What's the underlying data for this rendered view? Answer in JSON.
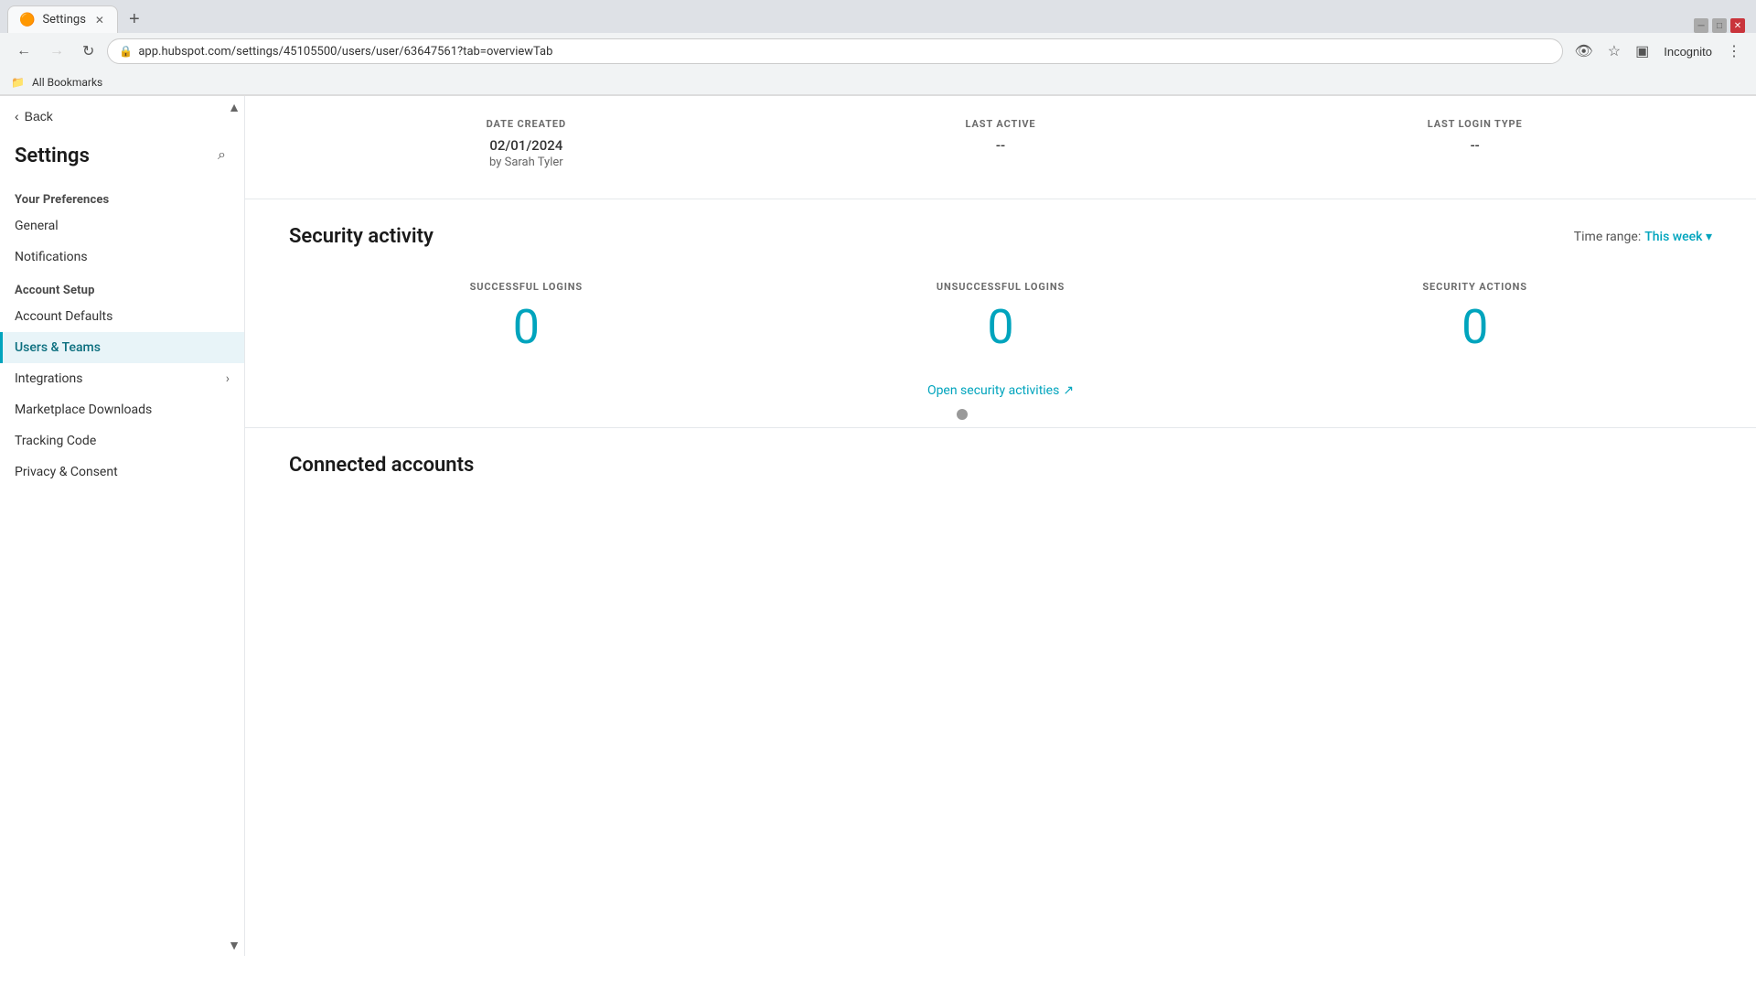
{
  "browser": {
    "tab_label": "Settings",
    "tab_icon": "⚙",
    "url": "app.hubspot.com/settings/45105500/users/user/63647561?tab=overviewTab",
    "new_tab_label": "+",
    "bookmarks_bar_label": "All Bookmarks",
    "nav": {
      "back_disabled": false,
      "forward_disabled": true
    }
  },
  "sidebar": {
    "back_label": "Back",
    "title": "Settings",
    "search_icon": "🔍",
    "sections": [
      {
        "id": "your-preferences",
        "label": "Your Preferences",
        "items": [
          {
            "id": "general",
            "label": "General",
            "active": false,
            "has_children": false
          },
          {
            "id": "notifications",
            "label": "Notifications",
            "active": false,
            "has_children": false
          }
        ]
      },
      {
        "id": "account-setup",
        "label": "Account Setup",
        "items": [
          {
            "id": "account-defaults",
            "label": "Account Defaults",
            "active": false,
            "has_children": false
          },
          {
            "id": "users-teams",
            "label": "Users & Teams",
            "active": true,
            "has_children": false
          },
          {
            "id": "integrations",
            "label": "Integrations",
            "active": false,
            "has_children": true
          },
          {
            "id": "marketplace-downloads",
            "label": "Marketplace Downloads",
            "active": false,
            "has_children": false
          },
          {
            "id": "tracking-code",
            "label": "Tracking Code",
            "active": false,
            "has_children": false
          },
          {
            "id": "privacy-consent",
            "label": "Privacy & Consent",
            "active": false,
            "has_children": false
          }
        ]
      }
    ]
  },
  "main": {
    "info_cards": [
      {
        "label": "DATE CREATED",
        "value": "02/01/2024",
        "sub": "by Sarah Tyler"
      },
      {
        "label": "LAST ACTIVE",
        "value": "--",
        "sub": ""
      },
      {
        "label": "LAST LOGIN TYPE",
        "value": "--",
        "sub": ""
      }
    ],
    "security_activity": {
      "title": "Security activity",
      "time_range_label": "Time range:",
      "time_range_value": "This week",
      "stats": [
        {
          "label": "SUCCESSFUL LOGINS",
          "value": "0"
        },
        {
          "label": "UNSUCCESSFUL LOGINS",
          "value": "0"
        },
        {
          "label": "SECURITY ACTIONS",
          "value": "0"
        }
      ],
      "open_link_label": "Open security activities",
      "open_link_icon": "↗"
    },
    "connected_accounts": {
      "title": "Connected accounts"
    }
  }
}
